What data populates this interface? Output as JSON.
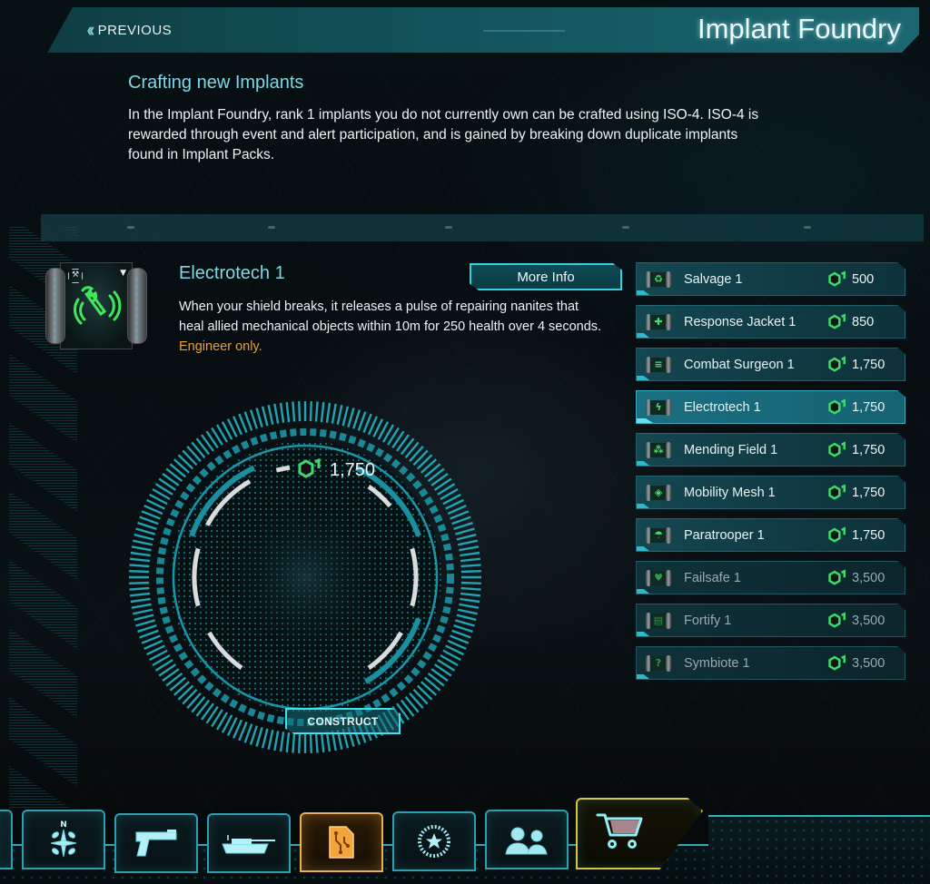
{
  "header": {
    "previous_label": "PREVIOUS",
    "previous_icon": "double-chevron-left-icon",
    "title": "Implant Foundry"
  },
  "intro": {
    "title": "Crafting new Implants",
    "body": "In the Implant Foundry, rank 1 implants you do not currently own can be crafted using ISO-4. ISO-4 is rewarded through event and alert participation, and is gained by breaking down duplicate implants found in Implant Packs."
  },
  "selected_implant": {
    "name": "Electrotech 1",
    "description": "When your shield breaks, it releases a pulse of repairing nanites that heal allied mechanical objects within 10m for 250 health over 4 seconds.",
    "restriction": "Engineer only.",
    "icon": "wrench-pulse-icon",
    "more_info_label": "More Info",
    "cost": "1,750",
    "construct_label": "CONSTRUCT"
  },
  "colors": {
    "accent_cyan": "#37d0e3",
    "title_cyan": "#7fd8e4",
    "restriction_orange": "#e5a03a",
    "iso_green": "#3ddc6a",
    "active_tab_orange": "#e8b05a",
    "store_tab_yellow": "#d7c640"
  },
  "implants": [
    {
      "name": "Salvage 1",
      "cost": "500",
      "glyph": "♻",
      "state": "available"
    },
    {
      "name": "Response Jacket 1",
      "cost": "850",
      "glyph": "✚",
      "state": "available"
    },
    {
      "name": "Combat Surgeon 1",
      "cost": "1,750",
      "glyph": "≡",
      "state": "available"
    },
    {
      "name": "Electrotech 1",
      "cost": "1,750",
      "glyph": "ϟ",
      "state": "selected"
    },
    {
      "name": "Mending Field 1",
      "cost": "1,750",
      "glyph": "⁂",
      "state": "available"
    },
    {
      "name": "Mobility Mesh 1",
      "cost": "1,750",
      "glyph": "◈",
      "state": "available"
    },
    {
      "name": "Paratrooper 1",
      "cost": "1,750",
      "glyph": "☂",
      "state": "available"
    },
    {
      "name": "Failsafe 1",
      "cost": "3,500",
      "glyph": "♥",
      "state": "locked"
    },
    {
      "name": "Fortify 1",
      "cost": "3,500",
      "glyph": "▤",
      "state": "locked"
    },
    {
      "name": "Symbiote 1",
      "cost": "3,500",
      "glyph": "?",
      "state": "locked"
    }
  ],
  "bottom_nav": [
    {
      "id": "partial",
      "icon": "tab-edge"
    },
    {
      "id": "map",
      "icon": "compass-icon"
    },
    {
      "id": "loadouts",
      "icon": "pistol-icon"
    },
    {
      "id": "vehicles",
      "icon": "tank-icon"
    },
    {
      "id": "implants",
      "icon": "implant-document-icon",
      "active": true
    },
    {
      "id": "directives",
      "icon": "star-medal-icon"
    },
    {
      "id": "social",
      "icon": "friends-icon"
    },
    {
      "id": "store",
      "icon": "shopping-cart-icon"
    }
  ]
}
